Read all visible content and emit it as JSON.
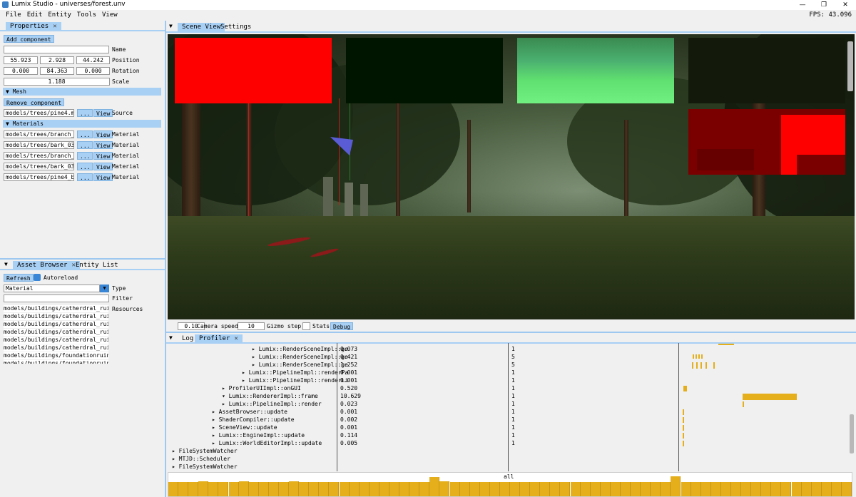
{
  "window": {
    "title": "Lumix Studio - universes/forest.unv",
    "minimize": "—",
    "restore": "❐",
    "close": "✕",
    "fps": "FPS: 43.096"
  },
  "menu": [
    "File",
    "Edit",
    "Entity",
    "Tools",
    "View"
  ],
  "properties": {
    "tab": "Properties",
    "add_component": "Add component",
    "name_label": "Name",
    "name_value": "",
    "position_label": "Position",
    "position": [
      "55.923",
      "2.928",
      "44.242"
    ],
    "rotation_label": "Rotation",
    "rotation": [
      "0.000",
      "84.363",
      "0.000"
    ],
    "scale_label": "Scale",
    "scale": "1.188",
    "mesh_header": "▼  Mesh",
    "remove_component": "Remove component",
    "source_path": "models/trees/pine4.msh",
    "browse": "...",
    "view": "View",
    "source_label": "Source",
    "materials_header": "▼  Materials",
    "material_label": "Material",
    "materials": [
      "models/trees/branch_pi",
      "models/trees/bark_03.m",
      "models/trees/branch_pi",
      "models/trees/bark_03.m",
      "models/trees/pine4_bil"
    ]
  },
  "asset_browser": {
    "tab": "Asset Browser",
    "tab2": "Entity List",
    "refresh": "Refresh",
    "autoreload": "Autoreload",
    "type_value": "Material",
    "type_label": "Type",
    "filter_label": "Filter",
    "resources_label": "Resources",
    "items": [
      "models/buildings/catherdral_ruir",
      "models/buildings/catherdral_ruir",
      "models/buildings/catherdral_ruir",
      "models/buildings/catherdral_ruir",
      "models/buildings/catherdral_ruir",
      "models/buildings/catherdral_ruir",
      "models/buildings/foundationruin_",
      "models/buildings/foundationruin_"
    ]
  },
  "scene": {
    "tab": "Scene View",
    "tab2": "Settings",
    "camera_speed_value": "0.10",
    "camera_speed_label": "Camera speed",
    "gizmo_step_value": "10",
    "gizmo_step_label": "Gizmo step",
    "stats_label": "Stats",
    "debug_button": "Debug"
  },
  "profiler": {
    "tab_log": "Log",
    "tab": "Profiler",
    "rows": [
      {
        "name": "Lumix::RenderSceneImpl::ge",
        "time": "0.073",
        "hits": "1"
      },
      {
        "name": "Lumix::RenderSceneImpl::ge",
        "time": "0.421",
        "hits": "5"
      },
      {
        "name": "Lumix::RenderSceneImpl::ge",
        "time": "1.252",
        "hits": "5"
      },
      {
        "name": "Lumix::PipelineImpl::renderPa",
        "time": "0.001",
        "hits": "1"
      },
      {
        "name": "Lumix::PipelineImpl::renderLi",
        "time": "0.001",
        "hits": "1"
      },
      {
        "name": "ProfilerUIImpl::onGUI",
        "time": "0.520",
        "hits": "1"
      },
      {
        "name": "Lumix::RendererImpl::frame",
        "time": "10.629",
        "hits": "1"
      },
      {
        "name": "Lumix::PipelineImpl::render",
        "time": "0.023",
        "hits": "1"
      },
      {
        "name": "AssetBrowser::update",
        "time": "0.001",
        "hits": "1"
      },
      {
        "name": "ShaderCompiler::update",
        "time": "0.002",
        "hits": "1"
      },
      {
        "name": "SceneView::update",
        "time": "0.001",
        "hits": "1"
      },
      {
        "name": "Lumix::EngineImpl::update",
        "time": "0.114",
        "hits": "1"
      },
      {
        "name": "Lumix::WorldEditorImpl::update",
        "time": "0.005",
        "hits": "1"
      }
    ],
    "threads": [
      "FileSystemWatcher",
      "MTJD::Scheduler",
      "FileSystemWatcher"
    ],
    "hist_label": "all"
  },
  "colors": {
    "accent": "#a8d0f5",
    "bar": "#e4af1a"
  }
}
